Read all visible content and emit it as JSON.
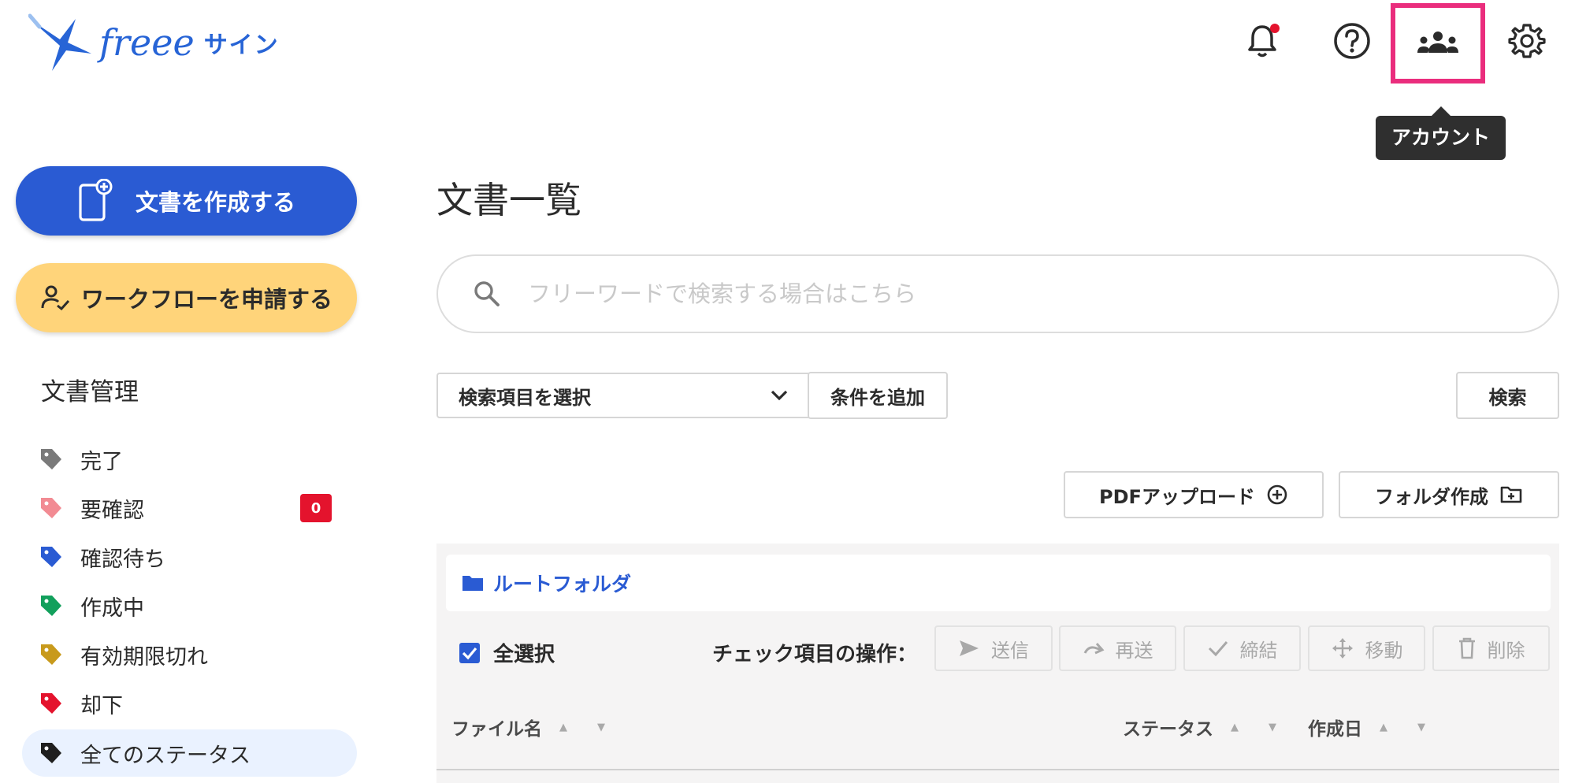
{
  "header": {
    "brand": "freee",
    "product": "サイン",
    "tooltip": "アカウント"
  },
  "sidebar": {
    "create_label": "文書を作成する",
    "workflow_label": "ワークフローを申請する",
    "section_title": "文書管理",
    "statuses": [
      {
        "label": "完了",
        "color": "#7a7a7a"
      },
      {
        "label": "要確認",
        "color": "#f28b93",
        "badge": "0"
      },
      {
        "label": "確認待ち",
        "color": "#2a5bd3"
      },
      {
        "label": "作成中",
        "color": "#12a05c"
      },
      {
        "label": "有効期限切れ",
        "color": "#c89a1c"
      },
      {
        "label": "却下",
        "color": "#e4132d"
      },
      {
        "label": "全てのステータス",
        "color": "#1f1f1f"
      }
    ]
  },
  "main": {
    "title": "文書一覧",
    "search_placeholder": "フリーワードで検索する場合はこちら",
    "field_select": "検索項目を選択",
    "add_condition": "条件を追加",
    "search_button": "検索",
    "pdf_upload": "PDFアップロード",
    "create_folder": "フォルダ作成",
    "breadcrumb": "ルートフォルダ",
    "select_all": "全選択",
    "bulk_label": "チェック項目の操作：",
    "bulk_actions": [
      "送信",
      "再送",
      "締結",
      "移動",
      "削除"
    ],
    "columns": [
      "ファイル名",
      "ステータス",
      "作成日"
    ]
  },
  "colors": {
    "primary": "#2a5bd3",
    "workflow": "#ffd47a",
    "highlight": "#ea2d7d",
    "alert": "#e4132d"
  }
}
